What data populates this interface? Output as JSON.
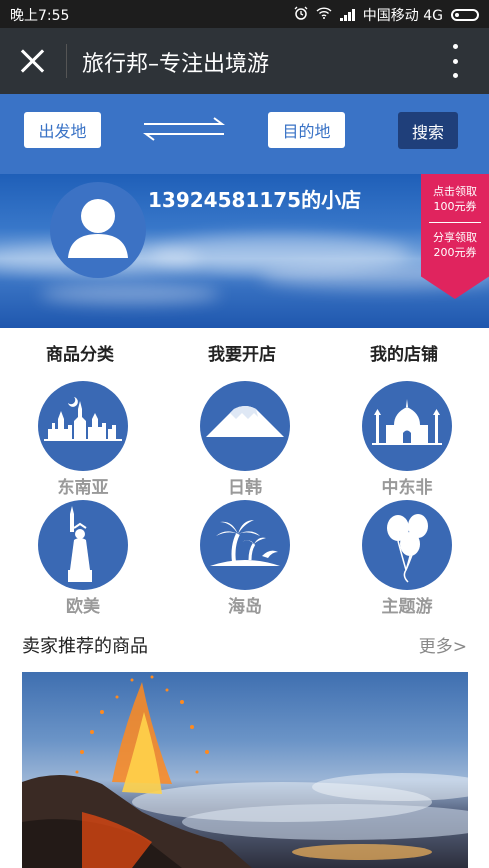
{
  "status_bar": {
    "time": "晚上7:55",
    "carrier": "中国移动 4G"
  },
  "title_bar": {
    "title": "旅行邦–专注出境游"
  },
  "search": {
    "from_label": "出发地",
    "to_label": "目的地",
    "search_label": "搜索"
  },
  "banner": {
    "shop_name": "13924581175的小店"
  },
  "promo": {
    "line1a": "点击领取",
    "line1b": "100元券",
    "line2a": "分享领取",
    "line2b": "200元券"
  },
  "tabs": [
    "商品分类",
    "我要开店",
    "我的店铺"
  ],
  "categories": [
    {
      "label": "东南亚",
      "icon": "southeast-asia-temple-icon"
    },
    {
      "label": "日韩",
      "icon": "mount-fuji-icon"
    },
    {
      "label": "中东非",
      "icon": "taj-mahal-icon"
    },
    {
      "label": "欧美",
      "icon": "statue-of-liberty-icon"
    },
    {
      "label": "海岛",
      "icon": "palm-island-icon"
    },
    {
      "label": "主题游",
      "icon": "balloons-icon"
    }
  ],
  "recommend": {
    "title": "卖家推荐的商品",
    "more": "更多>"
  },
  "colors": {
    "primary": "#3a73c6",
    "dark": "#2e3338",
    "promo": "#e0245e",
    "search_button": "#1f3f7a"
  }
}
